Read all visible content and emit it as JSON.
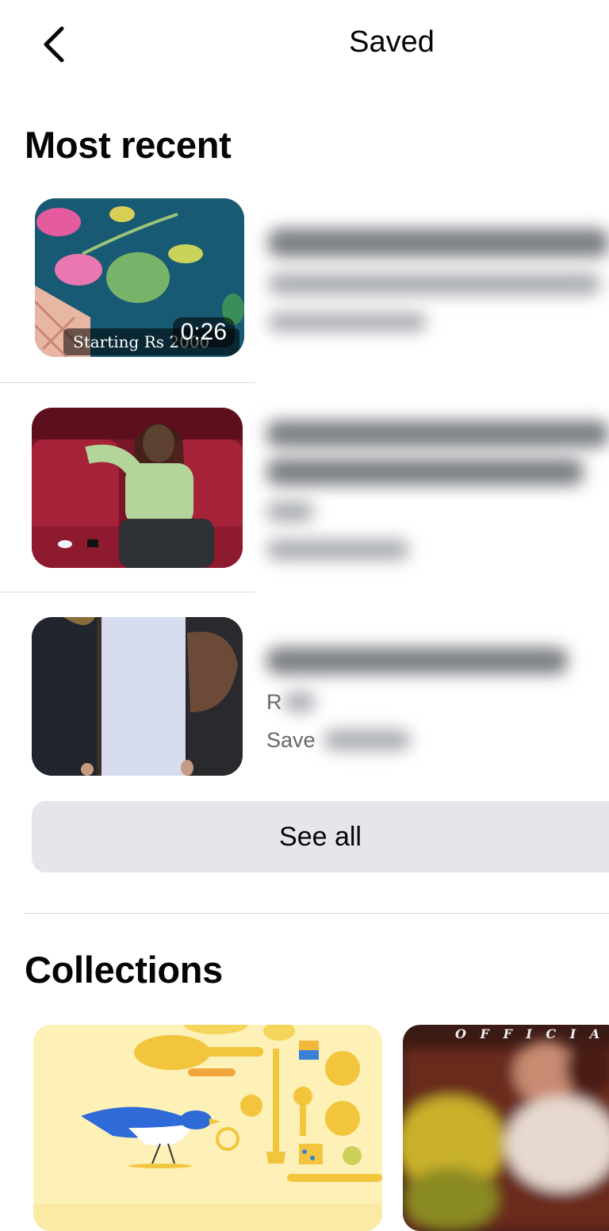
{
  "header": {
    "title": "Saved",
    "back_icon": "chevron-left-icon"
  },
  "most_recent": {
    "title": "Most recent",
    "items": [
      {
        "caption_overlay": "Starting Rs 2000",
        "duration": "0:26"
      },
      {},
      {
        "type_partial": "R",
        "saved_partial": "Save"
      }
    ],
    "see_all_label": "See all"
  },
  "collections": {
    "title": "Collections",
    "cards": [
      {
        "name": ""
      },
      {
        "banner": "O F F I C I A L   T"
      }
    ]
  },
  "colors": {
    "button_bg": "#e4e6eb",
    "divider": "#d9dadd",
    "meta": "#65676b"
  }
}
